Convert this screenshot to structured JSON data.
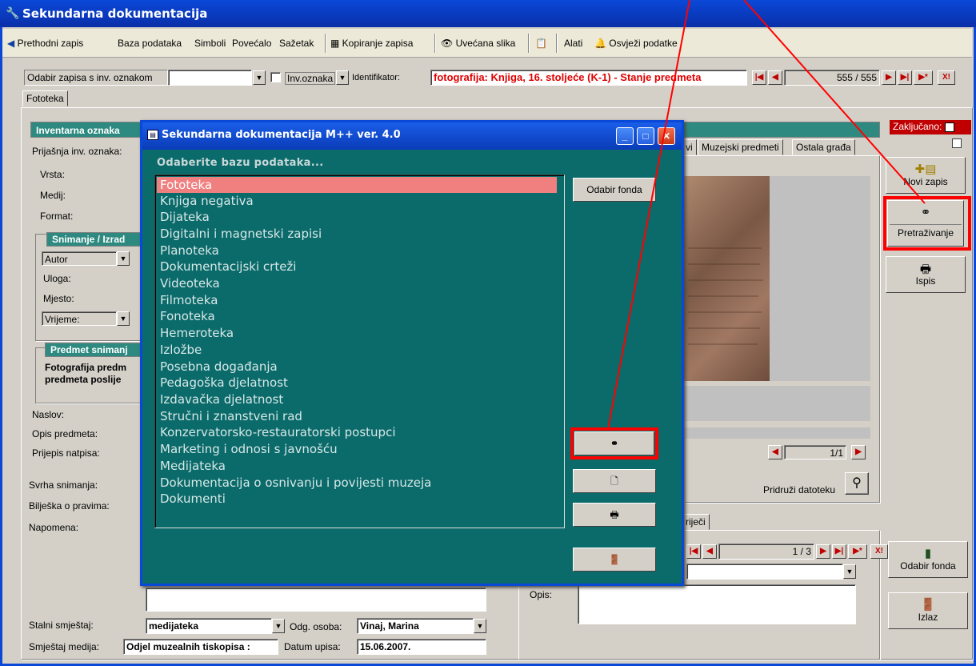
{
  "window": {
    "title": "Sekundarna dokumentacija",
    "app_icon": "wrench-icon"
  },
  "menu": {
    "back": "Prethodni zapis",
    "items": [
      "Baza podataka",
      "Simboli",
      "Povećalo",
      "Sažetak"
    ],
    "copy": "Kopiranje zapisa",
    "zoom": "Uvećana slika",
    "tools": "Alati",
    "refresh": "Osvježi podatke"
  },
  "navbar": {
    "select_label": "Odabir zapisa s inv. oznakom",
    "inv_label": "Inv.oznaka",
    "identifier_label": "Identifikator:",
    "identifier_value": "fotografija: Knjiga, 16. stoljeće (K-1) - Stanje predmeta",
    "record_counter": "555 / 555"
  },
  "tabs": {
    "main": "Fototeka"
  },
  "form": {
    "inv_header": "Inventarna oznaka",
    "prev_inv": "Prijašnja inv. oznaka:",
    "vrsta": "Vrsta:",
    "medij": "Medij:",
    "format": "Format:",
    "snimanje_header": "Snimanje / Izrad",
    "autor": "Autor",
    "uloga": "Uloga:",
    "mjesto": "Mjesto:",
    "vrijeme": "Vrijeme:",
    "predmet_header": "Predmet snimanj",
    "predmet_text1": "Fotografija predm",
    "predmet_text2": "predmeta poslije",
    "naslov": "Naslov:",
    "opis_predmeta": "Opis predmeta:",
    "prijepis": "Prijepis natpisa:",
    "svrha": "Svrha snimanja:",
    "biljeska": "Bilješka o pravima:",
    "napomena": "Napomena:",
    "stalni": "Stalni smještaj:",
    "stalni_value": "medijateka",
    "odg_label": "Odg. osoba:",
    "odg_value": "Vinaj, Marina",
    "smjestaj_label": "Smještaj medija:",
    "smjestaj_value": "Odjel muzealnih tiskopisa :",
    "datum_label": "Datum upisa:",
    "datum_value": "15.06.2007."
  },
  "right": {
    "tab1": "vi",
    "tab2": "Muzejski predmeti",
    "tab3": "Ostala građa",
    "locked": "Zaključano:",
    "image_counter": "1/1",
    "attach": "Pridruži datoteku",
    "kw_tab": "riječi",
    "kw_counter": "1 / 3",
    "opis": "Opis:"
  },
  "side_buttons": {
    "new": "Novi zapis",
    "search": "Pretraživanje",
    "print": "Ispis",
    "fond": "Odabir fonda",
    "exit": "Izlaz"
  },
  "dialog": {
    "title": "Sekundarna dokumentacija M++ ver. 4.0",
    "prompt": "Odaberite bazu podataka...",
    "fond_button": "Odabir fonda",
    "databases": [
      "Fototeka",
      "Knjiga negativa",
      "Dijateka",
      "Digitalni i magnetski zapisi",
      "Planoteka",
      "Dokumentacijski crteži",
      "Videoteka",
      "Filmoteka",
      "Fonoteka",
      "Hemeroteka",
      "Izložbe",
      "Posebna događanja",
      "Pedagoška djelatnost",
      "Izdavačka djelatnost",
      "Stručni i znanstveni rad",
      "Konzervatorsko-restauratorski postupci",
      "Marketing i odnosi s javnošću",
      "Medijateka",
      "Dokumentacija o osnivanju i povijesti muzeja",
      "Dokumenti"
    ],
    "selected_index": 0
  },
  "colors": {
    "accent": "#2e8a80",
    "highlight": "#ff0000",
    "selection": "#f08080"
  }
}
